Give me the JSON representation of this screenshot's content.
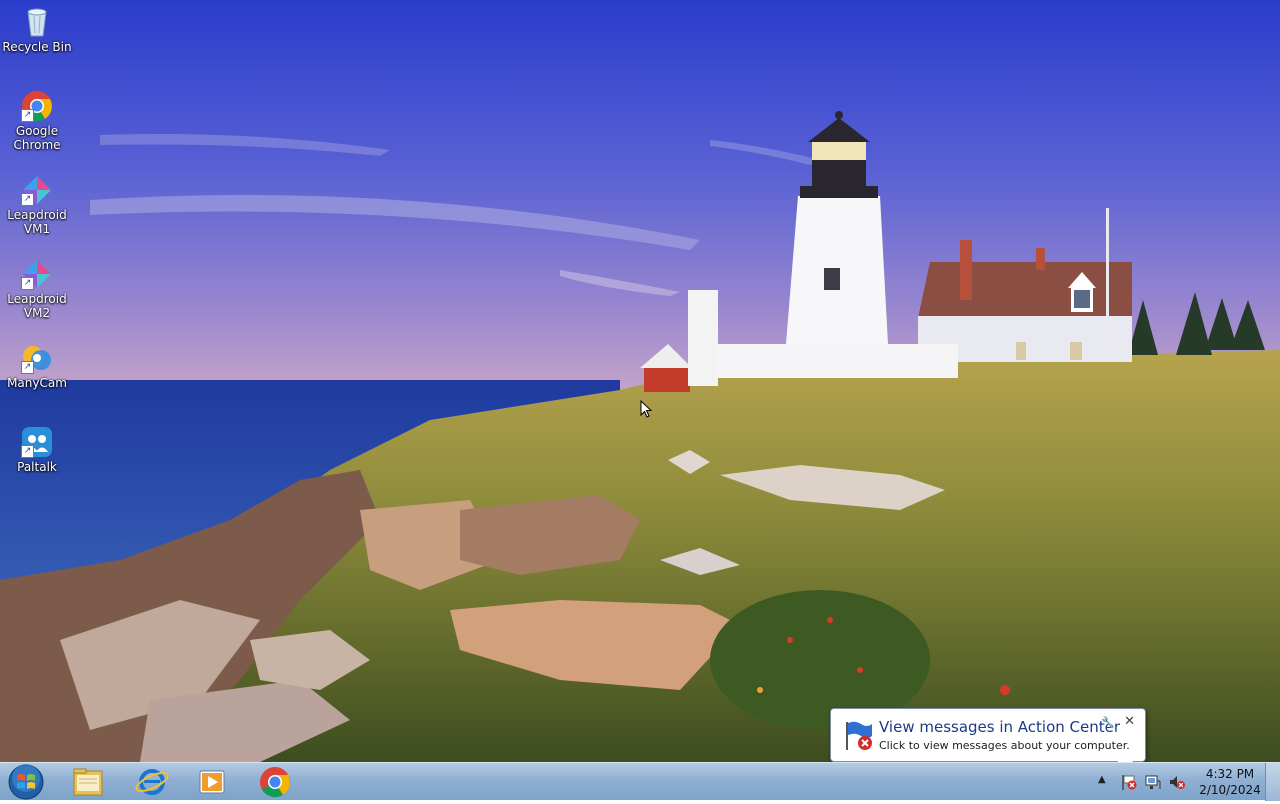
{
  "desktop": {
    "icons": [
      {
        "name": "recycle-bin",
        "label": "Recycle Bin",
        "icon": "recycle-bin-icon"
      },
      {
        "name": "google-chrome",
        "label": "Google\nChrome",
        "icon": "chrome-icon"
      },
      {
        "name": "leapdroid-vm1",
        "label": "Leapdroid\nVM1",
        "icon": "leapdroid-icon"
      },
      {
        "name": "leapdroid-vm2",
        "label": "Leapdroid\nVM2",
        "icon": "leapdroid-icon"
      },
      {
        "name": "manycam",
        "label": "ManyCam",
        "icon": "manycam-icon"
      },
      {
        "name": "paltalk",
        "label": "Paltalk",
        "icon": "paltalk-icon"
      }
    ],
    "wallpaper": "lighthouse-on-rocky-coast"
  },
  "notification": {
    "title": "View messages in Action Center",
    "message": "Click to view messages about your computer.",
    "icon": "action-center-flag-icon"
  },
  "taskbar": {
    "start_icon": "windows-orb-icon",
    "pinned": [
      {
        "name": "file-explorer",
        "icon": "folder-icon"
      },
      {
        "name": "internet-explorer",
        "icon": "ie-icon"
      },
      {
        "name": "media-player",
        "icon": "media-player-icon"
      },
      {
        "name": "google-chrome",
        "icon": "chrome-icon"
      }
    ],
    "tray": {
      "icons": [
        "action-center-flag-icon",
        "network-icon",
        "volume-muted-icon"
      ],
      "time": "4:32 PM",
      "date": "2/10/2024"
    }
  },
  "colors": {
    "sky_top": "#2c3fc6",
    "sky_bottom": "#9d8ccf",
    "sea": "#2a4ea8",
    "grass": "#8a8a3a",
    "taskbar": "#9bb8d7",
    "balloon_title": "#1c3a8b"
  }
}
